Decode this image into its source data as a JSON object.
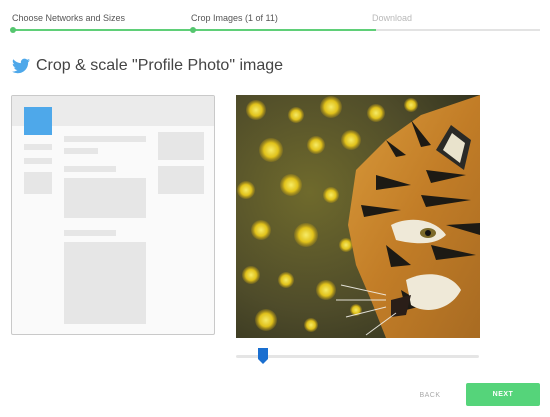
{
  "steps": [
    {
      "label": "Choose Networks and Sizes",
      "state": "complete"
    },
    {
      "label": "Crop Images (1 of 11)",
      "state": "current"
    },
    {
      "label": "Download",
      "state": "disabled"
    }
  ],
  "header": {
    "icon": "twitter-bird-icon",
    "title": "Crop & scale \"Profile Photo\" image"
  },
  "colors": {
    "accent_green": "#55d47a",
    "twitter_blue": "#4ea8ea",
    "slider_blue": "#1a6fd0"
  },
  "crop": {
    "zoom_fraction": 0.1
  },
  "buttons": {
    "back": "BACK",
    "next": "NEXT"
  }
}
